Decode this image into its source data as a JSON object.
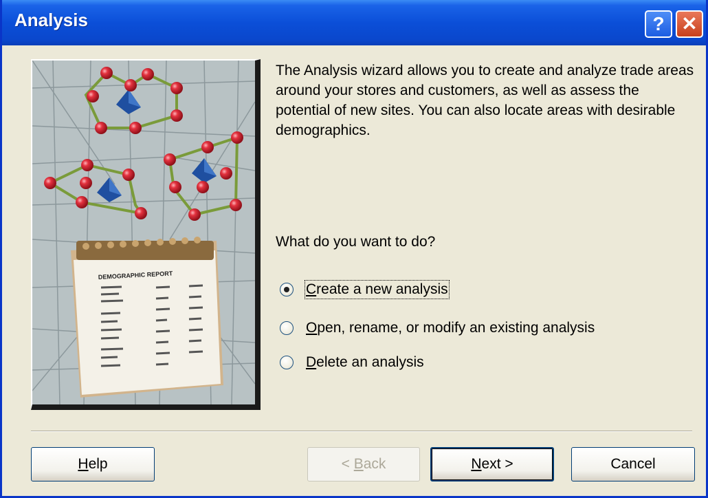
{
  "window": {
    "title": "Analysis"
  },
  "titlebar_buttons": {
    "help_glyph": "?",
    "close_glyph": "✕"
  },
  "illustration": {
    "report_heading": "DEMOGRAPHIC REPORT"
  },
  "description": "The Analysis wizard allows you to create and analyze trade areas around your stores and customers, as well as assess the potential of new sites. You can also locate areas with desirable demographics.",
  "question": "What do you want to do?",
  "options": [
    {
      "mnemonic": "C",
      "rest": "reate a new analysis",
      "selected": true
    },
    {
      "mnemonic": "O",
      "rest": "pen, rename, or modify an existing analysis",
      "selected": false
    },
    {
      "mnemonic": "D",
      "rest": "elete an analysis",
      "selected": false
    }
  ],
  "buttons": {
    "help": {
      "mnemonic": "H",
      "rest": "elp"
    },
    "back": {
      "prefix": "< ",
      "mnemonic": "B",
      "rest": "ack",
      "enabled": false
    },
    "next": {
      "mnemonic": "N",
      "rest": "ext >"
    },
    "cancel": {
      "label": "Cancel"
    }
  },
  "colors": {
    "titlebar": "#0a47cc",
    "dialog_bg": "#ece9d8",
    "point_red": "#d81e2c",
    "trade_area_line": "#7a9b3a",
    "store_marker": "#1f4fa0"
  }
}
